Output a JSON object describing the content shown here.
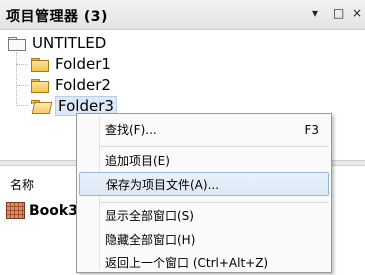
{
  "panel": {
    "title": "项目管理器 (3)",
    "dropdown_icon": "▾",
    "restore_icon": "□",
    "close_icon": "×"
  },
  "tree": {
    "root": "UNTITLED",
    "folders": [
      "Folder1",
      "Folder2",
      "Folder3"
    ]
  },
  "lower": {
    "column_header": "名称",
    "item": "Book3"
  },
  "context_menu": {
    "items": [
      {
        "label": "查找(F)...",
        "shortcut": "F3"
      },
      {
        "label": "追加项目(E)",
        "shortcut": ""
      },
      {
        "label": "保存为项目文件(A)...",
        "shortcut": ""
      },
      {
        "label": "显示全部窗口(S)",
        "shortcut": ""
      },
      {
        "label": "隐藏全部窗口(H)",
        "shortcut": ""
      },
      {
        "label": "返回上一个窗口 (Ctrl+Alt+Z)",
        "shortcut": ""
      }
    ],
    "highlighted_index": 2
  },
  "colors": {
    "highlight": "#dbe8f6",
    "folder": "#f2c24f"
  }
}
